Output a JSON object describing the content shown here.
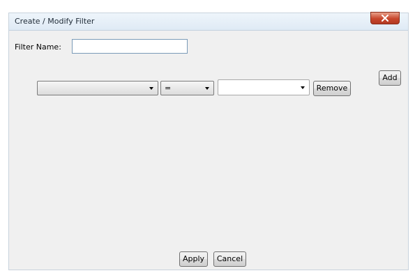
{
  "window": {
    "title": "Create / Modify Filter",
    "close_icon": "close-x-icon",
    "close_color": "#c8472d"
  },
  "filter_name": {
    "label": "Filter Name:",
    "value": ""
  },
  "buttons": {
    "add": "Add",
    "remove": "Remove",
    "apply": "Apply",
    "cancel": "Cancel"
  },
  "condition_row": {
    "field_value": "",
    "operator_value": "=",
    "value_value": ""
  }
}
